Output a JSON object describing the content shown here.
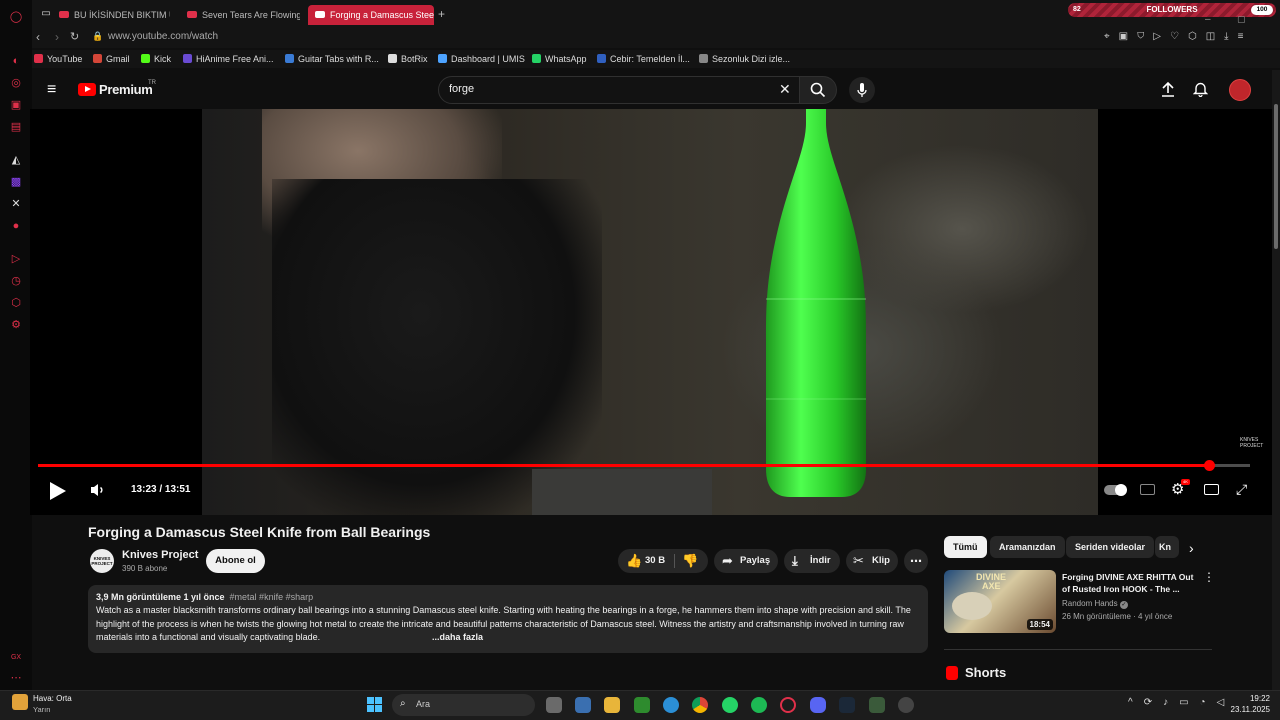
{
  "browser": {
    "tabs": [
      {
        "label": "BU İKİSİNDEN BIKTIM UL..."
      },
      {
        "label": "Seven Tears Are Flowing"
      },
      {
        "label": "Forging a Damascus Stee"
      }
    ],
    "followers_label": "FOLLOWERS",
    "followers_left": "82",
    "followers_right": "100",
    "url": "www.youtube.com/watch",
    "bookmarks": [
      {
        "label": "YouTube",
        "color": "#e0304a"
      },
      {
        "label": "Gmail",
        "color": "#d44638"
      },
      {
        "label": "Kick",
        "color": "#53fc18"
      },
      {
        "label": "HiAnime Free Ani...",
        "color": "#6a4bd3"
      },
      {
        "label": "Guitar Tabs with R...",
        "color": "#3a7bd5"
      },
      {
        "label": "BotRix",
        "color": "#dddddd"
      },
      {
        "label": "Dashboard | UMIS",
        "color": "#4da3ff"
      },
      {
        "label": "WhatsApp",
        "color": "#25d366"
      },
      {
        "label": "Cebir: Temelden İl...",
        "color": "#3060c0"
      },
      {
        "label": "Sezonluk Dizi izle...",
        "color": "#888888"
      }
    ]
  },
  "youtube": {
    "logo_text": "Premium",
    "region": "TR",
    "search_value": "forge",
    "player": {
      "time": "13:23 / 13:51",
      "progress": 0.966,
      "watermark": "KNIVES PROJECT"
    },
    "video": {
      "title": "Forging a Damascus Steel Knife from Ball Bearings",
      "channel": "Knives Project",
      "channel_avatar": "KNIVES PROJECT",
      "subscribers": "390 B abone",
      "subscribe_label": "Abone ol",
      "likes": "30 B",
      "share_label": "Paylaş",
      "download_label": "İndir",
      "clip_label": "Klip",
      "views_date": "3,9 Mn görüntüleme  1 yıl önce",
      "tags": "#metal #knife #sharp",
      "description": "Watch as a master blacksmith transforms ordinary ball bearings into a stunning Damascus steel knife. Starting with heating the bearings in a forge, he hammers them into shape with precision and skill. The highlight of the process is when he twists the glowing hot metal to create the intricate and beautiful patterns characteristic of Damascus steel. Witness the artistry and craftsmanship involved in turning raw materials into a functional and visually captivating blade.",
      "more_label": "...daha fazla"
    },
    "chips": [
      "Tümü",
      "Aramanızdan",
      "Seriden videolar",
      "Kn"
    ],
    "recommended": {
      "title": "Forging DIVINE AXE RHITTA Out of Rusted Iron HOOK - The ...",
      "channel": "Random Hands",
      "meta": "26 Mn görüntüleme · 4 yıl önce",
      "duration": "18:54",
      "thumb_text_1": "DIVINE",
      "thumb_text_2": "AXE"
    },
    "shorts_label": "Shorts"
  },
  "taskbar": {
    "weather_title": "Hava: Orta",
    "weather_sub": "Yarın",
    "search_placeholder": "Ara",
    "time": "19:22",
    "date": "23.11.2025"
  },
  "colors": {
    "accent": "#e0304a",
    "youtube_red": "#ff0000"
  }
}
